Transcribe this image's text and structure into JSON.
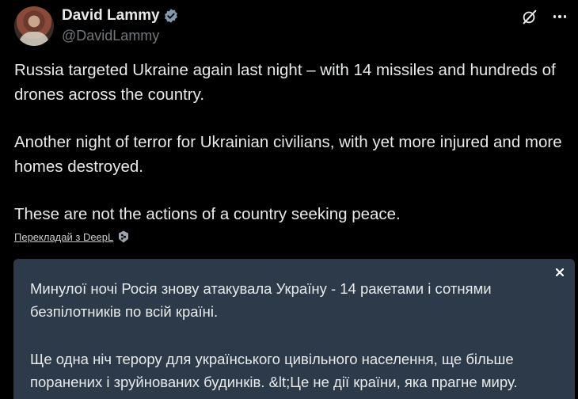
{
  "author": {
    "display_name": "David Lammy",
    "handle": "@DavidLammy"
  },
  "icons": {
    "avatar": "profile-photo",
    "verified": "verified-badge-icon",
    "grok": "grok-icon",
    "more": "more-options-icon",
    "deepl": "deepl-icon",
    "close": "close-icon"
  },
  "colors": {
    "background": "#000000",
    "text": "#e7e9ea",
    "muted": "#71767b",
    "verified_badge": "#829aab",
    "translation_bg": "#2c3a49"
  },
  "tweet": {
    "paragraphs": [
      "Russia targeted Ukraine again last night – with 14 missiles and hundreds of drones across the country.",
      "Another night of terror for Ukrainian civilians, with yet more injured and more homes destroyed.",
      "These are not the actions of a country seeking peace."
    ]
  },
  "translate": {
    "link_label": "Перекладай з DeepL"
  },
  "translation": {
    "paragraphs": [
      "Минулої ночі Росія знову атакувала Україну - 14 ракетами і сотнями безпілотників по всій країні.",
      "Ще одна ніч терору для українського цивільного населення, ще більше поранених і зруйнованих будинків. &lt;Це не дії країни, яка прагне миру."
    ]
  }
}
